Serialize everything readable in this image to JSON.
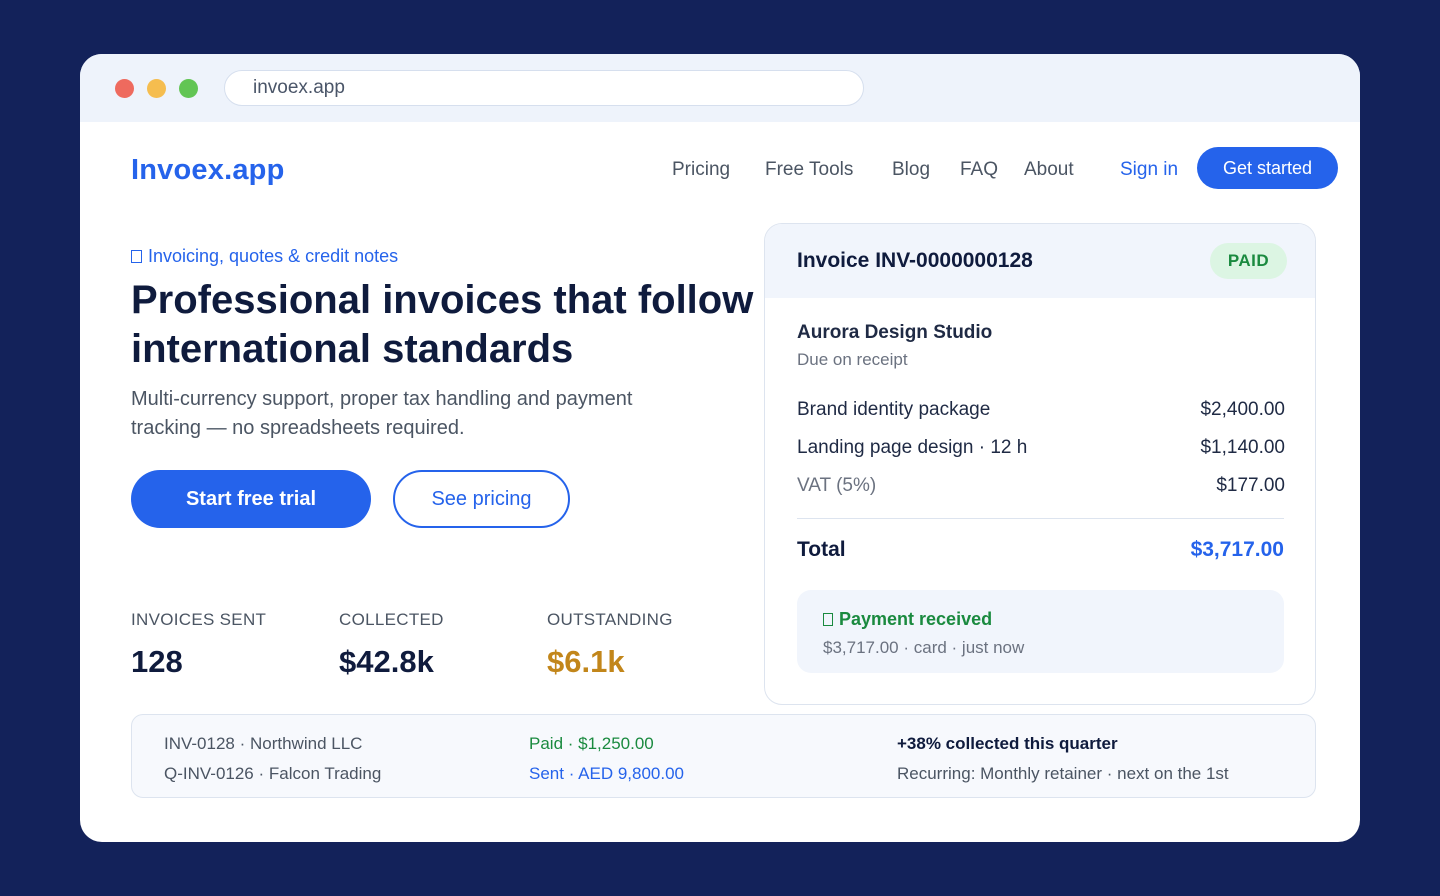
{
  "browser": {
    "url": "invoex.app"
  },
  "header": {
    "logo": "Invoex.app",
    "nav": [
      "Pricing",
      "Free Tools",
      "Blog",
      "FAQ",
      "About"
    ],
    "sign_in": "Sign in",
    "cta": "Get started"
  },
  "hero": {
    "eyebrow": "Invoicing, quotes & credit notes",
    "title": "Professional invoices that follow international standards",
    "subtitle": "Multi-currency support, proper tax handling and payment tracking — no spreadsheets required.",
    "primary_button": "Start free trial",
    "secondary_button": "See pricing"
  },
  "stats": [
    {
      "label": "INVOICES SENT",
      "value": "128"
    },
    {
      "label": "COLLECTED",
      "value": "$42.8k"
    },
    {
      "label": "OUTSTANDING",
      "value": "$6.1k"
    }
  ],
  "invoice": {
    "title": "Invoice INV-0000000128",
    "status": "PAID",
    "client": "Aurora Design Studio",
    "terms": "Due on receipt",
    "items": [
      {
        "description": "Brand identity package",
        "amount": "$2,400.00"
      },
      {
        "description": "Landing page design · 12 h",
        "amount": "$1,140.00"
      },
      {
        "description": "VAT (5%)",
        "amount": "$177.00"
      }
    ],
    "total_label": "Total",
    "total_value": "$3,717.00",
    "payment": {
      "title": "Payment received",
      "detail": "$3,717.00 · card · just now"
    }
  },
  "activity": {
    "rows": [
      {
        "invoice": "INV-0128 · Northwind LLC",
        "status": "Paid · $1,250.00"
      },
      {
        "invoice": "Q-INV-0126 · Falcon Trading",
        "status": "Sent · AED 9,800.00"
      }
    ],
    "insight": "+38% collected this quarter",
    "recurring": "Recurring: Monthly retainer · next on the 1st"
  },
  "colors": {
    "background": "#13225a",
    "accent": "#2563eb",
    "paid_green": "#1a8a3f",
    "outstanding_amber": "#c2861a"
  }
}
